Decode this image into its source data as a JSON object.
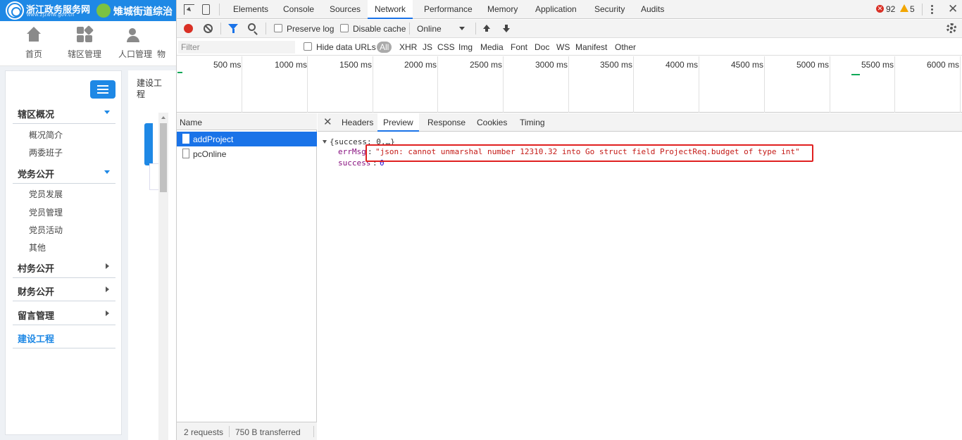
{
  "webpage": {
    "site_name": "浙江政务服务网",
    "site_url": "www.zjzwfw.gov.cn",
    "site2_name": "雉城街道综治",
    "nav": [
      {
        "label": "首页",
        "icon": "home-icon"
      },
      {
        "label": "辖区管理",
        "icon": "grid-icon"
      },
      {
        "label": "人口管理",
        "icon": "people-icon"
      },
      {
        "label": "物",
        "icon": ""
      }
    ],
    "sidebar": {
      "sections": [
        {
          "label": "辖区概况",
          "expanded": true,
          "items": [
            "概况简介",
            "两委班子"
          ]
        },
        {
          "label": "党务公开",
          "expanded": true,
          "items": [
            "党员发展",
            "党员管理",
            "党员活动",
            "其他"
          ]
        },
        {
          "label": "村务公开",
          "expanded": false,
          "items": []
        },
        {
          "label": "财务公开",
          "expanded": false,
          "items": []
        },
        {
          "label": "留言管理",
          "expanded": false,
          "items": []
        },
        {
          "label": "建设工程",
          "expanded": false,
          "active": true,
          "items": []
        }
      ]
    },
    "content_title": "建设工程"
  },
  "devtools": {
    "tabs": [
      "Elements",
      "Console",
      "Sources",
      "Network",
      "Performance",
      "Memory",
      "Application",
      "Security",
      "Audits"
    ],
    "active_tab": "Network",
    "errors": "92",
    "warnings": "5",
    "toolbar": {
      "preserve_log": "Preserve log",
      "disable_cache": "Disable cache",
      "throttling": "Online"
    },
    "filterbar": {
      "placeholder": "Filter",
      "hide_data_urls": "Hide data URLs",
      "types": [
        "All",
        "XHR",
        "JS",
        "CSS",
        "Img",
        "Media",
        "Font",
        "Doc",
        "WS",
        "Manifest",
        "Other"
      ],
      "active_type": "All"
    },
    "timeline": {
      "ticks": [
        "500 ms",
        "1000 ms",
        "1500 ms",
        "2000 ms",
        "2500 ms",
        "3000 ms",
        "3500 ms",
        "4000 ms",
        "4500 ms",
        "5000 ms",
        "5500 ms",
        "6000 ms"
      ]
    },
    "requests": {
      "header": "Name",
      "rows": [
        {
          "name": "addProject",
          "selected": true
        },
        {
          "name": "pcOnline",
          "selected": false
        }
      ],
      "footer": {
        "count": "2 requests",
        "transferred": "750 B transferred"
      }
    },
    "details": {
      "tabs": [
        "Headers",
        "Preview",
        "Response",
        "Cookies",
        "Timing"
      ],
      "active_tab": "Preview",
      "preview": {
        "root": "{success: 0,…}",
        "errMsg_key": "errMsg",
        "errMsg_value": "\"json: cannot unmarshal number 12310.32 into Go struct field ProjectReq.budget of type int\"",
        "success_key": "success",
        "success_value": "0"
      }
    }
  },
  "colors": {
    "accent": "#1a73e8",
    "site_blue": "#1e88e5",
    "highlight": "#e02020",
    "error": "#d93025",
    "warning": "#f2a600"
  }
}
